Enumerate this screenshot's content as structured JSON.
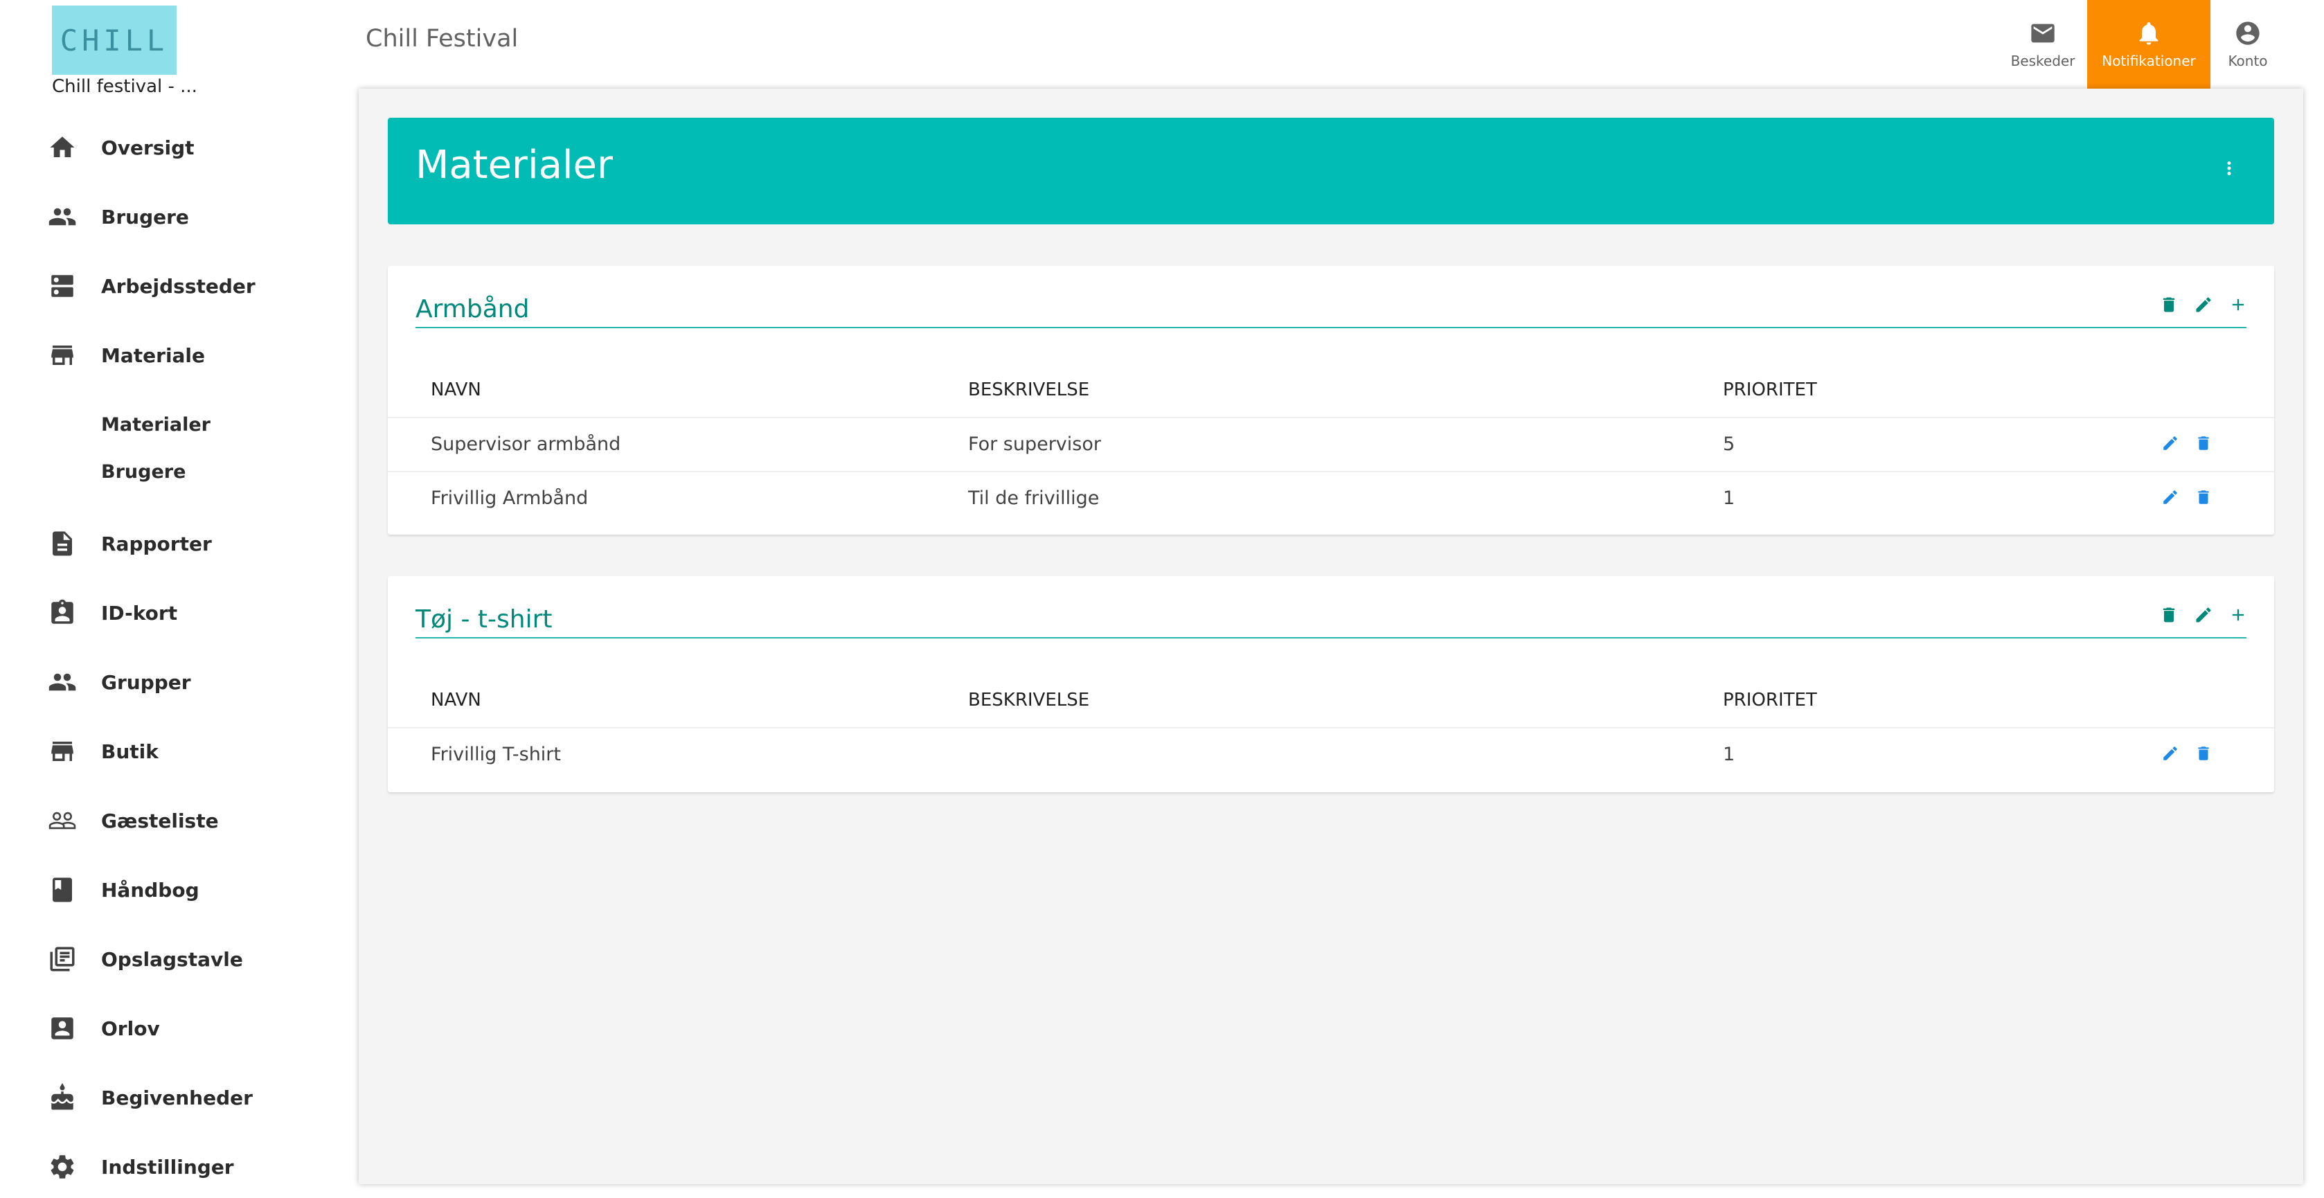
{
  "sidebar": {
    "logo_text": "CHILL",
    "org_name": "Chill festival - ...",
    "items": [
      {
        "label": "Oversigt",
        "icon": "home-icon"
      },
      {
        "label": "Brugere",
        "icon": "people-icon"
      },
      {
        "label": "Arbejdssteder",
        "icon": "dns-icon"
      },
      {
        "label": "Materiale",
        "icon": "store-icon"
      },
      {
        "label": "Rapporter",
        "icon": "description-icon"
      },
      {
        "label": "ID-kort",
        "icon": "badge-icon"
      },
      {
        "label": "Grupper",
        "icon": "people-icon"
      },
      {
        "label": "Butik",
        "icon": "store-icon"
      },
      {
        "label": "Gæsteliste",
        "icon": "people-outline-icon"
      },
      {
        "label": "Håndbog",
        "icon": "book-icon"
      },
      {
        "label": "Opslagstavle",
        "icon": "library-books-icon"
      },
      {
        "label": "Orlov",
        "icon": "contact-icon"
      },
      {
        "label": "Begivenheder",
        "icon": "cake-icon"
      },
      {
        "label": "Indstillinger",
        "icon": "gear-icon"
      }
    ],
    "subitems": [
      {
        "label": "Materialer"
      },
      {
        "label": "Brugere"
      }
    ]
  },
  "topbar": {
    "title": "Chill Festival",
    "buttons": [
      {
        "label": "Beskeder",
        "icon": "mail-icon"
      },
      {
        "label": "Notifikationer",
        "icon": "bell-icon"
      },
      {
        "label": "Konto",
        "icon": "account-circle-icon"
      }
    ]
  },
  "page": {
    "title": "Materialer"
  },
  "categories": [
    {
      "title": "Armbånd",
      "headers": [
        "NAVN",
        "BESKRIVELSE",
        "PRIORITET"
      ],
      "rows": [
        {
          "name": "Supervisor armbånd",
          "description": "For supervisor",
          "priority": "5"
        },
        {
          "name": "Frivillig Armbånd",
          "description": "Til de frivillige",
          "priority": "1"
        }
      ]
    },
    {
      "title": "Tøj - t-shirt",
      "headers": [
        "NAVN",
        "BESKRIVELSE",
        "PRIORITET"
      ],
      "rows": [
        {
          "name": "Frivillig T-shirt",
          "description": "",
          "priority": "1"
        }
      ]
    }
  ],
  "colors": {
    "accent": "#00bcb4",
    "active_tab": "#fb8c00",
    "title_text": "#00897b",
    "row_action": "#1e88e5"
  }
}
